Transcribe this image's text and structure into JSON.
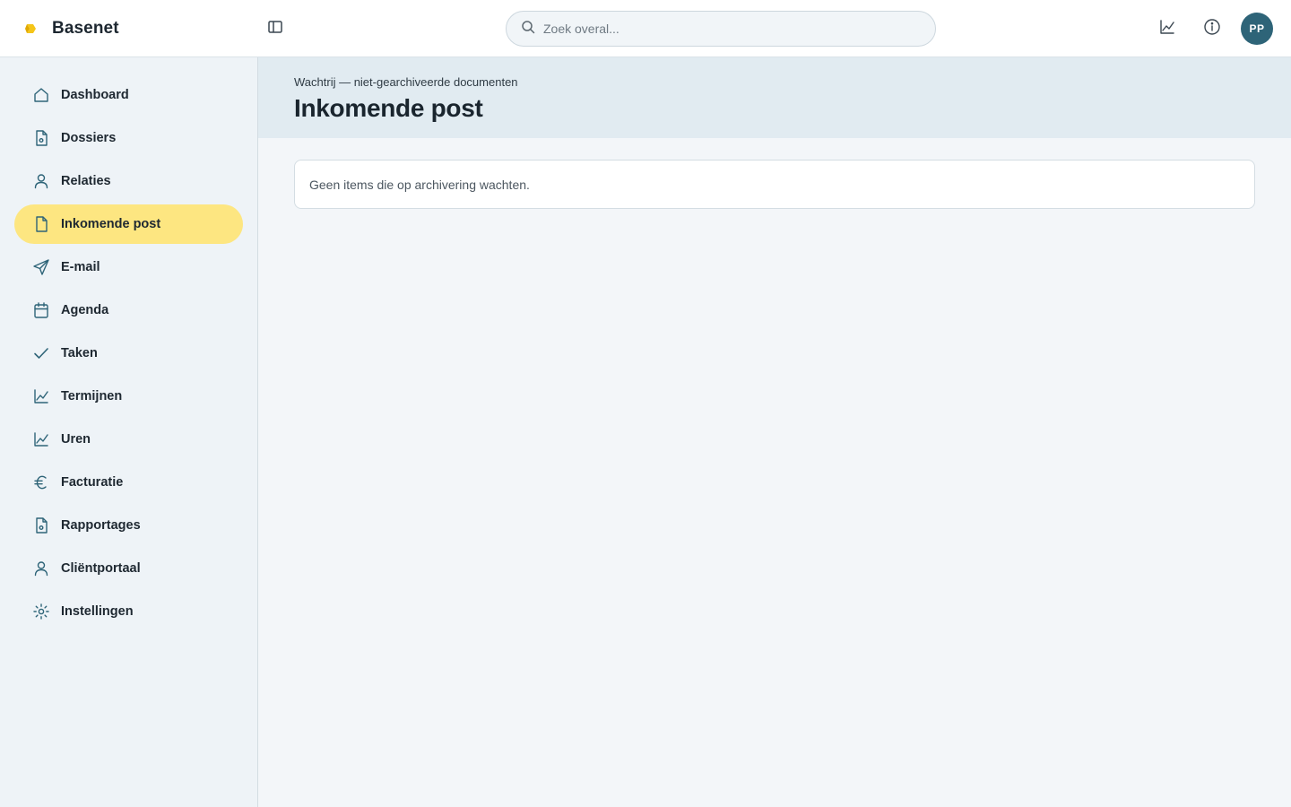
{
  "brand": {
    "name": "Basenet",
    "logo_color": "#f5c518"
  },
  "search": {
    "placeholder": "Zoek overal..."
  },
  "topbar": {
    "icons": [
      "sidebar-toggle-icon",
      "chart-icon",
      "info-icon"
    ],
    "avatar_initials": "PP",
    "avatar_color": "#2e6478"
  },
  "sidebar": {
    "active_color": "#fde681",
    "items": [
      {
        "label": "Dashboard",
        "icon": "home-icon"
      },
      {
        "label": "Dossiers",
        "icon": "file-icon"
      },
      {
        "label": "Relaties",
        "icon": "user-icon"
      },
      {
        "label": "Inkomende post",
        "icon": "document-icon",
        "active": true
      },
      {
        "label": "E-mail",
        "icon": "send-icon"
      },
      {
        "label": "Agenda",
        "icon": "calendar-icon"
      },
      {
        "label": "Taken",
        "icon": "check-icon"
      },
      {
        "label": "Termijnen",
        "icon": "chart-icon"
      },
      {
        "label": "Uren",
        "icon": "chart-icon"
      },
      {
        "label": "Facturatie",
        "icon": "euro-icon"
      },
      {
        "label": "Rapportages",
        "icon": "file-icon"
      },
      {
        "label": "Cliëntportaal",
        "icon": "user-icon"
      },
      {
        "label": "Instellingen",
        "icon": "settings-icon"
      }
    ]
  },
  "page": {
    "eyebrow": "Wachtrij — niet-gearchiveerde documenten",
    "title": "Inkomende post",
    "empty_message": "Geen items die op archivering wachten."
  }
}
